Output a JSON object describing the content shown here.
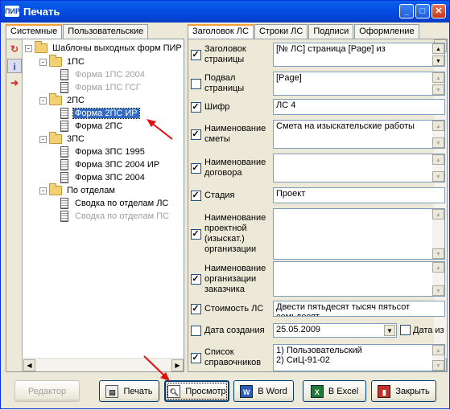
{
  "window": {
    "title": "Печать",
    "app_icon": "ПИР"
  },
  "left": {
    "tabs": [
      "Системные",
      "Пользовательские"
    ],
    "tree": [
      {
        "label": "Шаблоны выходных форм ПИР",
        "type": "folder",
        "level": 0,
        "expander": "-"
      },
      {
        "label": "1ПС",
        "type": "folder",
        "level": 1,
        "expander": "-"
      },
      {
        "label": "Форма 1ПС 2004",
        "type": "doc",
        "level": 2,
        "grey": true
      },
      {
        "label": "Форма 1ПС ГСГ",
        "type": "doc",
        "level": 2,
        "grey": true
      },
      {
        "label": "2ПС",
        "type": "folder",
        "level": 1,
        "expander": "-"
      },
      {
        "label": "Форма 2ПС ИР",
        "type": "doc",
        "level": 2,
        "selected": true
      },
      {
        "label": "Форма 2ПС",
        "type": "doc",
        "level": 2
      },
      {
        "label": "3ПС",
        "type": "folder",
        "level": 1,
        "expander": "-"
      },
      {
        "label": "Форма 3ПС 1995",
        "type": "doc",
        "level": 2
      },
      {
        "label": "Форма 3ПС 2004 ИР",
        "type": "doc",
        "level": 2
      },
      {
        "label": "Форма 3ПС 2004",
        "type": "doc",
        "level": 2
      },
      {
        "label": "По отделам",
        "type": "folder",
        "level": 1,
        "expander": "-"
      },
      {
        "label": "Сводка по отделам ЛС",
        "type": "doc",
        "level": 2
      },
      {
        "label": "Сводка по отделам ПС",
        "type": "doc",
        "level": 2,
        "grey": true
      }
    ]
  },
  "right": {
    "tabs": [
      "Заголовок ЛС",
      "Строки ЛС",
      "Подписи",
      "Оформление"
    ],
    "rows": [
      {
        "label": "Заголовок страницы",
        "checked": true,
        "value": "[№ ЛС] страница [Page] из"
      },
      {
        "label": "Подвал страницы",
        "checked": false,
        "value": "[Page]"
      },
      {
        "label": "Шифр",
        "checked": true,
        "value": "ЛС 4"
      },
      {
        "label": "Наименование сметы",
        "checked": true,
        "value": "Смета на изыскательские работы"
      },
      {
        "label": "Наименование договора",
        "checked": true,
        "value": ""
      },
      {
        "label": "Стадия",
        "checked": true,
        "value": "Проект"
      },
      {
        "label": "Наименование проектной (изыскат.) организации",
        "checked": true,
        "value": ""
      },
      {
        "label": "Наименование организации заказчика",
        "checked": true,
        "value": ""
      },
      {
        "label": "Стоимость ЛС",
        "checked": true,
        "value": "Двести пятьдесят тысяч пятьсот семьдесят"
      },
      {
        "label": "Дата создания",
        "checked": false,
        "value": "25.05.2009",
        "extra_label": "Дата из"
      },
      {
        "label": "Список справочников",
        "checked": true,
        "value": "1) Пользовательский\n2) СиЦ-91-02"
      }
    ]
  },
  "buttons": {
    "editor": "Редактор",
    "print": "Печать",
    "preview": "Просмотр",
    "word": "В Word",
    "excel": "В Excel",
    "close": "Закрыть"
  },
  "colors": {
    "title_bar": "#0343d4",
    "selection": "#316ac5",
    "annotation_arrow": "#e01010"
  }
}
